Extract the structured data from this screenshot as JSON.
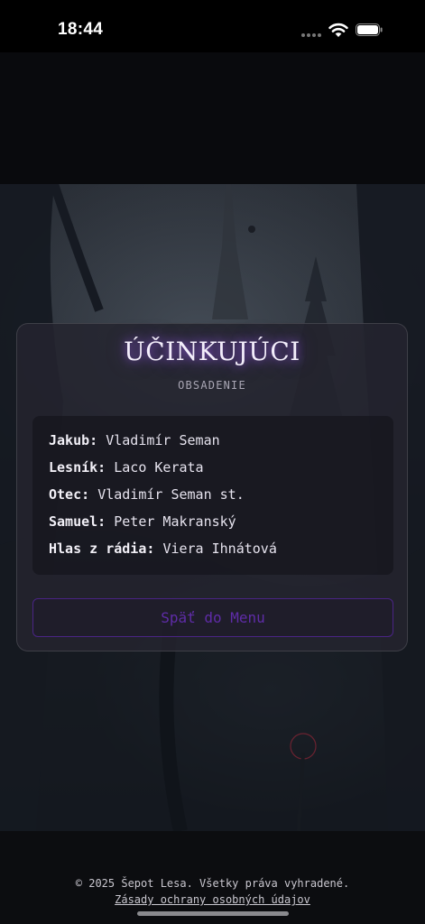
{
  "status_bar": {
    "time": "18:44"
  },
  "card": {
    "title": "ÚČINKUJÚCI",
    "subtitle": "OBSADENIE",
    "cast": [
      {
        "role": "Jakub:",
        "actor": "Vladimír Seman"
      },
      {
        "role": "Lesník:",
        "actor": "Laco Kerata"
      },
      {
        "role": "Otec:",
        "actor": "Vladimír Seman st."
      },
      {
        "role": "Samuel:",
        "actor": "Peter Makranský"
      },
      {
        "role": "Hlas z rádia:",
        "actor": "Viera Ihnátová"
      }
    ],
    "back_label": "Späť do Menu"
  },
  "footer": {
    "copyright": "© 2025 Šepot Lesa. Všetky práva vyhradené.",
    "privacy_link": "Zásady ochrany osobných údajov"
  },
  "colors": {
    "accent": "#5f2ca8",
    "accent_border": "#4a2485",
    "title_glow": "#a864ff",
    "card_bg": "#24242e"
  }
}
